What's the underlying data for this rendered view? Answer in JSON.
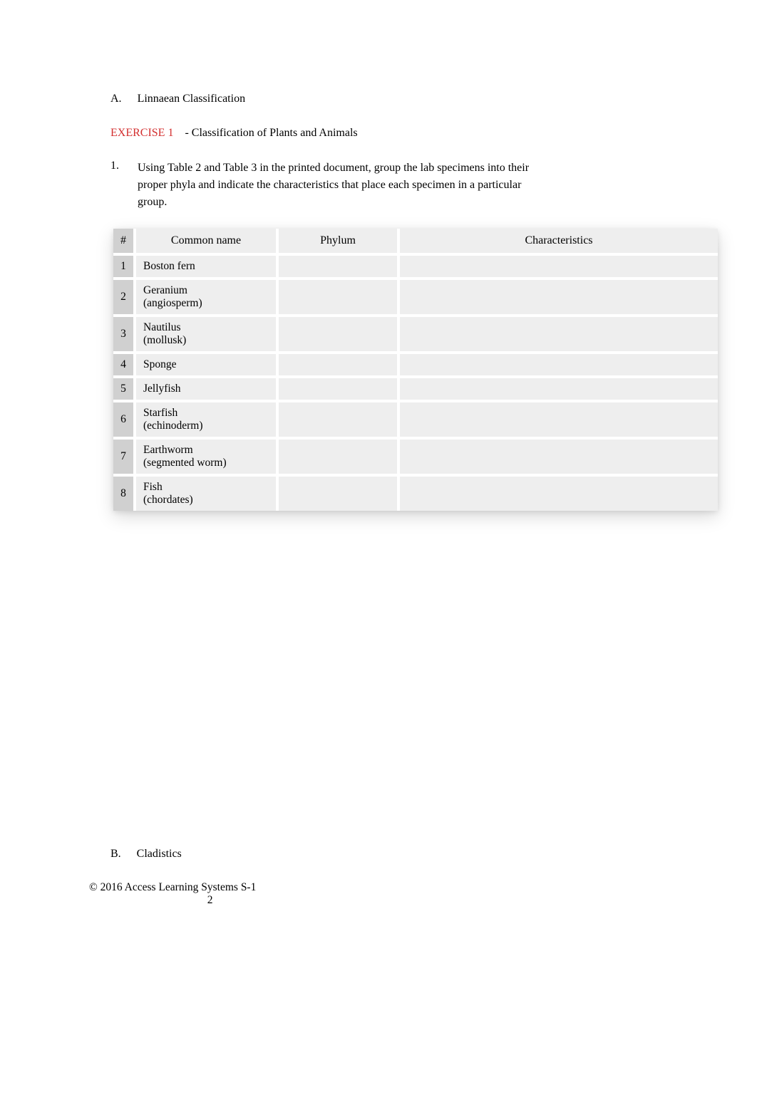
{
  "sectionA": {
    "letter": "A.",
    "title": "Linnaean Classification"
  },
  "exercise": {
    "label": "EXERCISE 1",
    "dash": "-",
    "title": "Classification of Plants and Animals"
  },
  "question": {
    "number": "1.",
    "text": "Using    Table 2     and    Table 3    in the printed document, group the lab specimens into their proper phyla and indicate the characteristics that place each specimen in a particular group."
  },
  "table": {
    "headers": {
      "col1": "#",
      "col2": "Common name",
      "col3": "Phylum",
      "col4": "Characteristics"
    },
    "rows": [
      {
        "num": "1",
        "name": "Boston fern",
        "name2": "",
        "phylum": "",
        "characteristics": ""
      },
      {
        "num": "2",
        "name": "Geranium",
        "name2": "(angiosperm)",
        "phylum": "",
        "characteristics": ""
      },
      {
        "num": "3",
        "name": "Nautilus",
        "name2": "(mollusk)",
        "phylum": "",
        "characteristics": ""
      },
      {
        "num": "4",
        "name": "Sponge",
        "name2": "",
        "phylum": "",
        "characteristics": ""
      },
      {
        "num": "5",
        "name": "Jellyfish",
        "name2": "",
        "phylum": "",
        "characteristics": ""
      },
      {
        "num": "6",
        "name": "Starfish",
        "name2": "(echinoderm)",
        "phylum": "",
        "characteristics": ""
      },
      {
        "num": "7",
        "name": "Earthworm",
        "name2": "(segmented worm)",
        "phylum": "",
        "characteristics": ""
      },
      {
        "num": "8",
        "name": "Fish",
        "name2": "(chordates)",
        "phylum": "",
        "characteristics": ""
      }
    ]
  },
  "sectionB": {
    "letter": "B.",
    "title": "Cladistics"
  },
  "footer": {
    "line1": "© 2016 Access Learning Systems   S-1",
    "line2": "2"
  }
}
